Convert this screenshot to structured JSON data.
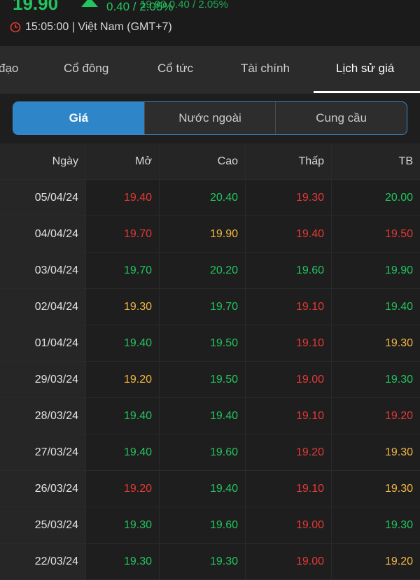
{
  "colors": {
    "up": "#22c55e",
    "down": "#e53935",
    "ref": "#f5b942"
  },
  "header": {
    "price": "19.90",
    "change_main": "0.40 / 2.05%",
    "change_overlay": "19.90 0.40 / 2.05%",
    "time": "15:05:00 | Việt Nam (GMT+7)"
  },
  "tabs": [
    {
      "label": "đạo"
    },
    {
      "label": "Cổ đông"
    },
    {
      "label": "Cổ tức"
    },
    {
      "label": "Tài chính"
    },
    {
      "label": "Lịch sử giá",
      "active": true
    }
  ],
  "segment": [
    "Giá",
    "Nước ngoài",
    "Cung cầu"
  ],
  "table": {
    "headers": [
      "Ngày",
      "Mở",
      "Cao",
      "Thấp",
      "TB"
    ],
    "rows": [
      {
        "date": "05/04/24",
        "open": "19.40",
        "high": "20.40",
        "low": "19.30",
        "avg": "20.00",
        "c": [
          "down",
          "up",
          "down",
          "up"
        ]
      },
      {
        "date": "04/04/24",
        "open": "19.70",
        "high": "19.90",
        "low": "19.40",
        "avg": "19.50",
        "c": [
          "down",
          "ref",
          "down",
          "down"
        ]
      },
      {
        "date": "03/04/24",
        "open": "19.70",
        "high": "20.20",
        "low": "19.60",
        "avg": "19.90",
        "c": [
          "up",
          "up",
          "up",
          "up"
        ]
      },
      {
        "date": "02/04/24",
        "open": "19.30",
        "high": "19.70",
        "low": "19.10",
        "avg": "19.40",
        "c": [
          "ref",
          "up",
          "down",
          "up"
        ]
      },
      {
        "date": "01/04/24",
        "open": "19.40",
        "high": "19.50",
        "low": "19.10",
        "avg": "19.30",
        "c": [
          "up",
          "up",
          "down",
          "ref"
        ]
      },
      {
        "date": "29/03/24",
        "open": "19.20",
        "high": "19.50",
        "low": "19.00",
        "avg": "19.30",
        "c": [
          "ref",
          "up",
          "down",
          "up"
        ]
      },
      {
        "date": "28/03/24",
        "open": "19.40",
        "high": "19.40",
        "low": "19.10",
        "avg": "19.20",
        "c": [
          "up",
          "up",
          "down",
          "down"
        ]
      },
      {
        "date": "27/03/24",
        "open": "19.40",
        "high": "19.60",
        "low": "19.20",
        "avg": "19.30",
        "c": [
          "up",
          "up",
          "down",
          "ref"
        ]
      },
      {
        "date": "26/03/24",
        "open": "19.20",
        "high": "19.40",
        "low": "19.10",
        "avg": "19.30",
        "c": [
          "down",
          "up",
          "down",
          "ref"
        ]
      },
      {
        "date": "25/03/24",
        "open": "19.30",
        "high": "19.60",
        "low": "19.00",
        "avg": "19.30",
        "c": [
          "up",
          "up",
          "down",
          "up"
        ]
      },
      {
        "date": "22/03/24",
        "open": "19.30",
        "high": "19.30",
        "low": "19.00",
        "avg": "19.20",
        "c": [
          "up",
          "up",
          "down",
          "ref"
        ]
      }
    ]
  }
}
